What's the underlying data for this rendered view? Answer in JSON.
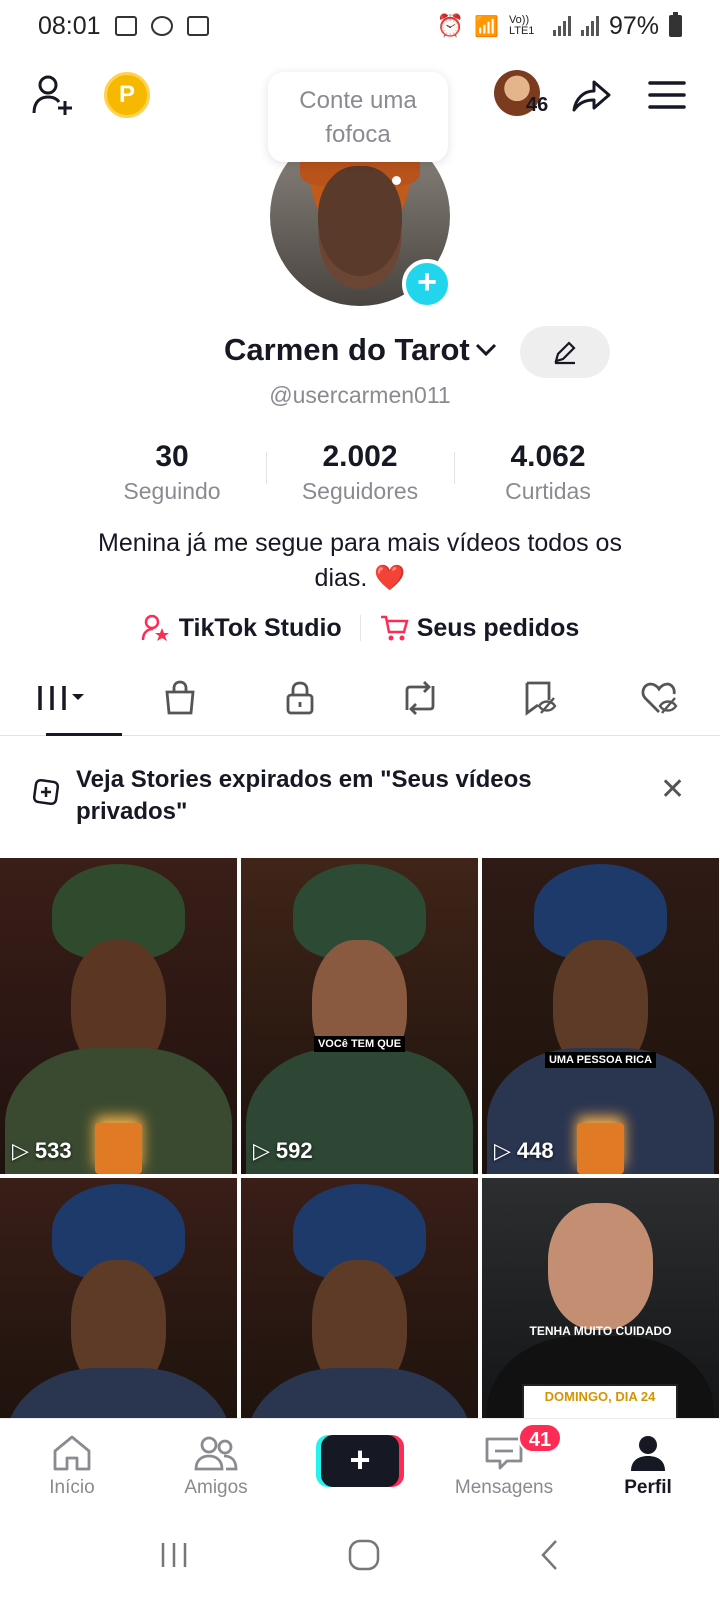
{
  "status_bar": {
    "time": "08:01",
    "battery": "97%",
    "network": "Vo)) LTE1"
  },
  "top_bar": {
    "coin_label": "P",
    "friends_count": "46"
  },
  "profile": {
    "bubble_text_line1": "Conte uma",
    "bubble_text_line2": "fofoca",
    "name": "Carmen do Tarot",
    "handle": "@usercarmen011",
    "bio_line1": "Menina já me segue para mais vídeos todos os",
    "bio_line2": "dias.",
    "bio_emoji": "❤️"
  },
  "stats": [
    {
      "value": "30",
      "label": "Seguindo"
    },
    {
      "value": "2.002",
      "label": "Seguidores"
    },
    {
      "value": "4.062",
      "label": "Curtidas"
    }
  ],
  "links": {
    "studio": "TikTok Studio",
    "orders": "Seus pedidos"
  },
  "banner": {
    "text": "Veja Stories expirados em \"Seus vídeos privados\""
  },
  "videos": [
    {
      "views": "533",
      "caption": ""
    },
    {
      "views": "592",
      "caption": "VOCê TEM QUE"
    },
    {
      "views": "448",
      "caption": "UMA PESSOA RICA"
    },
    {
      "views": "",
      "caption": ""
    },
    {
      "views": "",
      "caption": ""
    },
    {
      "views": "",
      "caption": "TENHA MUITO CUIDADO",
      "caption2": "DOMINGO, DIA 24"
    }
  ],
  "bottom_nav": {
    "home": "Início",
    "friends": "Amigos",
    "create": "+",
    "messages": "Mensagens",
    "messages_badge": "41",
    "profile": "Perfil"
  },
  "colors": {
    "accent": "#fe2c55",
    "cyan": "#20d5ec",
    "text": "#161823",
    "muted": "#8a8b91"
  }
}
